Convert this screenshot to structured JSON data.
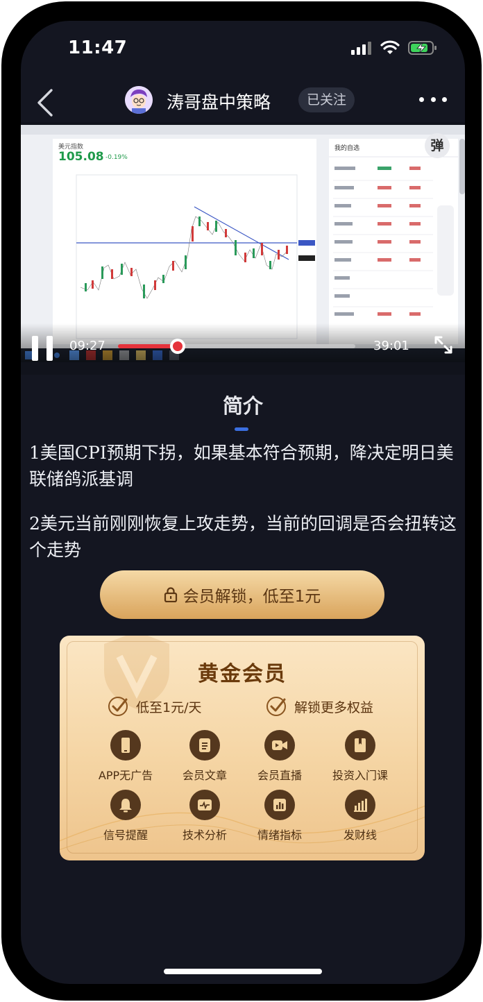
{
  "status": {
    "time": "11:47"
  },
  "nav": {
    "channel_name": "涛哥盘中策略",
    "follow_label": "已关注"
  },
  "player": {
    "danmu_label": "弹",
    "current_time": "09:27",
    "total_time": "39:01",
    "progress": 0.252,
    "screenshot": {
      "instrument": "美元指数",
      "price": "105.08",
      "change": "-0.19%",
      "watchlist_title": "我的自选"
    }
  },
  "intro": {
    "title": "简介",
    "paragraphs": [
      "1美国CPI预期下拐，如果基本符合预期，降决定明日美联储鸽派基调",
      "2美元当前刚刚恢复上攻走势，当前的回调是否会扭转这个走势"
    ]
  },
  "unlock": {
    "label": "会员解锁，低至1元"
  },
  "membership": {
    "title": "黄金会员",
    "perks": [
      "低至1元/天",
      "解锁更多权益"
    ],
    "features": [
      {
        "label": "APP无广告",
        "icon": "phone-icon"
      },
      {
        "label": "会员文章",
        "icon": "document-icon"
      },
      {
        "label": "会员直播",
        "icon": "video-camera-icon"
      },
      {
        "label": "投资入门课",
        "icon": "book-icon"
      },
      {
        "label": "信号提醒",
        "icon": "bell-icon"
      },
      {
        "label": "技术分析",
        "icon": "pulse-chart-icon"
      },
      {
        "label": "情绪指标",
        "icon": "bar-chart-icon"
      },
      {
        "label": "发财线",
        "icon": "trend-bars-icon"
      }
    ]
  },
  "colors": {
    "background": "#141621",
    "accent_blue": "#3b6fe0",
    "progress_red": "#e5333b",
    "gold_text": "#6a3a0c"
  }
}
